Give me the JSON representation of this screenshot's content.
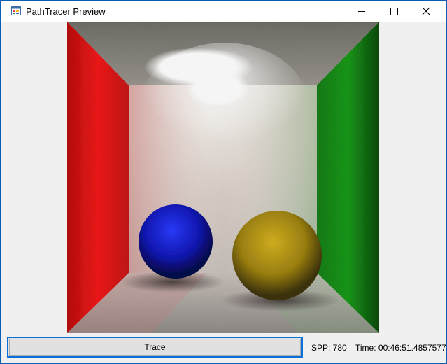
{
  "window": {
    "title": "PathTracer Preview",
    "icons": {
      "app": "app-window-icon",
      "minimize": "minimize-icon",
      "maximize": "maximize-icon",
      "close": "close-icon"
    }
  },
  "render": {
    "scene": "cornell-box"
  },
  "controls": {
    "trace_label": "Trace",
    "spp": "SPP: 780",
    "time": "Time: 00:46:51.4857577"
  },
  "colors": {
    "button_border": "#0a6fd8",
    "window_bg": "#f0f0f0",
    "desktop": "#0a5fb4"
  }
}
